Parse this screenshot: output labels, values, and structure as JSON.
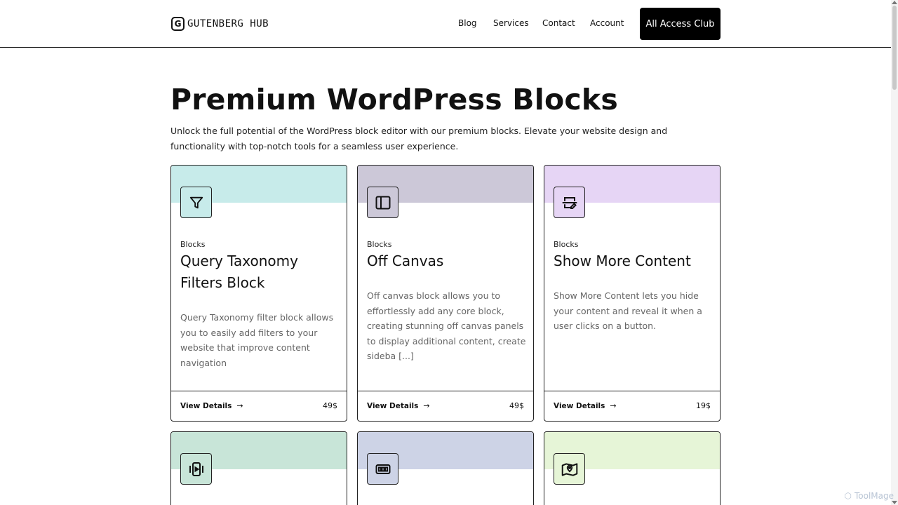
{
  "header": {
    "logo_mark": "G",
    "logo_text": "GUTENBERG HUB",
    "nav": [
      "Blog",
      "Services",
      "Contact",
      "Account"
    ],
    "cta_label": "All Access Club"
  },
  "hero": {
    "title": "Premium WordPress Blocks",
    "description": "Unlock the full potential of the WordPress block editor with our premium blocks. Elevate your website design and functionality with top-notch tools for a seamless user experience."
  },
  "cards": [
    {
      "category": "Blocks",
      "title": "Query Taxonomy Filters Block",
      "description": "Query Taxonomy filter block allows you to easily add filters to your website that improve content navigation",
      "link": "View Details",
      "price": "49$",
      "color": "#c7ebea",
      "icon": "funnel-icon"
    },
    {
      "category": "Blocks",
      "title": "Off Canvas",
      "description": "Off canvas block allows you to effortlessly add any core block, creating stunning off canvas panels to display additional content, create sideba [...]",
      "link": "View Details",
      "price": "49$",
      "color": "#ccc8d8",
      "icon": "sidebar-panel-icon"
    },
    {
      "category": "Blocks",
      "title": "Show More Content",
      "description": "Show More Content lets you hide your content and reveal it when a user clicks on a button.",
      "link": "View Details",
      "price": "19$",
      "color": "#e6d5f5",
      "icon": "expand-content-icon"
    },
    {
      "color": "#c8e5d8",
      "icon": "video-slider-icon"
    },
    {
      "color": "#cdd3e6",
      "icon": "gallery-strip-icon"
    },
    {
      "color": "#e6f5d7",
      "icon": "map-pin-icon"
    }
  ],
  "watermark": "ToolMage"
}
